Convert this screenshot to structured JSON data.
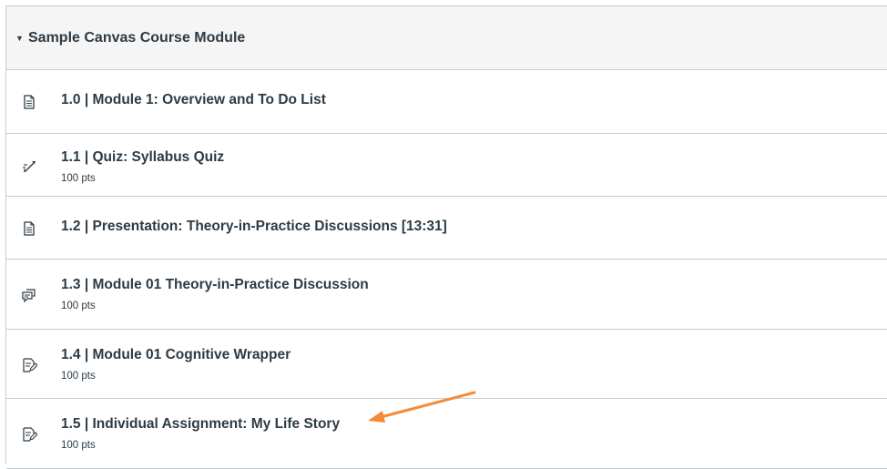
{
  "module": {
    "title": "Sample Canvas Course Module",
    "items": [
      {
        "label": "1.0 | Module 1: Overview and To Do List",
        "icon": "page-icon"
      },
      {
        "label": "1.1 | Quiz: Syllabus Quiz",
        "points": "100 pts",
        "icon": "quiz-icon"
      },
      {
        "label": "1.2 | Presentation: Theory-in-Practice Discussions [13:31]",
        "icon": "page-icon"
      },
      {
        "label": "1.3 | Module 01 Theory-in-Practice Discussion",
        "points": "100 pts",
        "icon": "discussion-icon"
      },
      {
        "label": "1.4 | Module 01 Cognitive Wrapper",
        "points": "100 pts",
        "icon": "assignment-icon"
      },
      {
        "label": "1.5 | Individual Assignment: My Life Story",
        "points": "100 pts",
        "icon": "assignment-icon"
      }
    ]
  },
  "colors": {
    "text": "#2d3b45",
    "border": "#c7cdd1",
    "header_bg": "#f5f5f5",
    "annotation_arrow": "#f28c3b"
  }
}
